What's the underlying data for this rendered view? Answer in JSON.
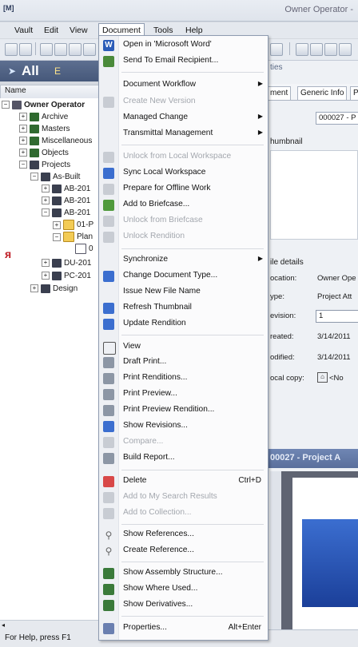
{
  "app": {
    "icon_text": "[M]",
    "title": "Owner Operator -"
  },
  "menubar": [
    "Vault",
    "Edit",
    "View",
    "Document",
    "Tools",
    "Help"
  ],
  "leftpanel": {
    "band_label": "All",
    "band_extra": "E",
    "header": "Name"
  },
  "tree": [
    {
      "label": "Owner Operator",
      "level": 0,
      "bold": true,
      "icon": "db"
    },
    {
      "label": "Archive",
      "level": 1,
      "icon": "book"
    },
    {
      "label": "Masters",
      "level": 1,
      "icon": "book"
    },
    {
      "label": "Miscellaneous",
      "level": 1,
      "icon": "book"
    },
    {
      "label": "Objects",
      "level": 1,
      "icon": "book"
    },
    {
      "label": "Projects",
      "level": 1,
      "icon": "proj"
    },
    {
      "label": "As-Built",
      "level": 2,
      "icon": "proj"
    },
    {
      "label": "AB-201",
      "level": 3,
      "icon": "proj"
    },
    {
      "label": "AB-201",
      "level": 3,
      "icon": "proj"
    },
    {
      "label": "AB-201",
      "level": 3,
      "icon": "proj"
    },
    {
      "label": "01-P",
      "level": 4,
      "icon": "folder"
    },
    {
      "label": "Plan",
      "level": 4,
      "icon": "folder"
    },
    {
      "label": "0",
      "level": 5,
      "icon": "doc"
    },
    {
      "label": "DU-201",
      "level": 3,
      "icon": "proj"
    },
    {
      "label": "PC-201",
      "level": 3,
      "icon": "proj"
    },
    {
      "label": "Design",
      "level": 2,
      "icon": "proj"
    }
  ],
  "dropdown": [
    {
      "label": "Open in 'Microsoft Word'",
      "icon": "word",
      "type": "item"
    },
    {
      "label": "Send To Email Recipient...",
      "icon": "mail",
      "type": "item"
    },
    {
      "type": "sep"
    },
    {
      "label": "Document Workflow",
      "type": "item",
      "submenu": true
    },
    {
      "label": "Create New Version",
      "icon": "grey",
      "type": "item",
      "disabled": true
    },
    {
      "label": "Managed Change",
      "type": "item",
      "submenu": true
    },
    {
      "label": "Transmittal Management",
      "type": "item",
      "submenu": true
    },
    {
      "type": "sep"
    },
    {
      "label": "Unlock from Local Workspace",
      "icon": "grey",
      "type": "item",
      "disabled": true
    },
    {
      "label": "Sync Local Workspace",
      "icon": "blue",
      "type": "item"
    },
    {
      "label": "Prepare for Offline Work",
      "icon": "grey",
      "type": "item"
    },
    {
      "label": "Add to Briefcase...",
      "icon": "green",
      "type": "item"
    },
    {
      "label": "Unlock from Briefcase",
      "icon": "grey",
      "type": "item",
      "disabled": true
    },
    {
      "label": "Unlock Rendition",
      "icon": "grey",
      "type": "item",
      "disabled": true
    },
    {
      "type": "sep"
    },
    {
      "label": "Synchronize",
      "type": "item",
      "submenu": true
    },
    {
      "label": "Change Document Type...",
      "icon": "blue",
      "type": "item"
    },
    {
      "label": "Issue New File Name",
      "type": "item"
    },
    {
      "label": "Refresh Thumbnail",
      "icon": "blue",
      "type": "item"
    },
    {
      "label": "Update Rendition",
      "icon": "blue",
      "type": "item"
    },
    {
      "type": "sep"
    },
    {
      "label": "View",
      "icon": "view",
      "type": "item"
    },
    {
      "label": "Draft Print...",
      "icon": "print",
      "type": "item"
    },
    {
      "label": "Print Renditions...",
      "icon": "print",
      "type": "item"
    },
    {
      "label": "Print Preview...",
      "icon": "print",
      "type": "item"
    },
    {
      "label": "Print Preview Rendition...",
      "icon": "print",
      "type": "item"
    },
    {
      "label": "Show Revisions...",
      "icon": "blue",
      "type": "item"
    },
    {
      "label": "Compare...",
      "icon": "grey",
      "type": "item",
      "disabled": true
    },
    {
      "label": "Build Report...",
      "icon": "print",
      "type": "item"
    },
    {
      "type": "sep"
    },
    {
      "label": "Delete",
      "icon": "red",
      "type": "item",
      "shortcut": "Ctrl+D"
    },
    {
      "label": "Add to My Search Results",
      "icon": "grey",
      "type": "item",
      "disabled": true
    },
    {
      "label": "Add to Collection...",
      "icon": "grey",
      "type": "item",
      "disabled": true
    },
    {
      "type": "sep"
    },
    {
      "label": "Show References...",
      "icon": "link",
      "type": "item"
    },
    {
      "label": "Create Reference...",
      "icon": "link",
      "type": "item"
    },
    {
      "type": "sep"
    },
    {
      "label": "Show Assembly Structure...",
      "icon": "tree",
      "type": "item"
    },
    {
      "label": "Show Where Used...",
      "icon": "tree",
      "type": "item"
    },
    {
      "label": "Show Derivatives...",
      "icon": "tree",
      "type": "item"
    },
    {
      "type": "sep"
    },
    {
      "label": "Properties...",
      "icon": "props",
      "type": "item",
      "shortcut": "Alt+Enter"
    }
  ],
  "rightpane": {
    "props_label": "ties",
    "tabs": [
      "ment",
      "Generic Info",
      "P"
    ],
    "doc_number": "000027 - P",
    "thumbnail_label": "humbnail",
    "file_details_label": "ile details",
    "fields": [
      {
        "label": "ocation:",
        "value": "Owner Ope"
      },
      {
        "label": "ype:",
        "value": "Project Att"
      },
      {
        "label": "evision:",
        "value": "1"
      },
      {
        "label": "reated:",
        "value": "3/14/2011"
      },
      {
        "label": "odified:",
        "value": "3/14/2011"
      },
      {
        "label": "ocal copy:",
        "value": "<No"
      }
    ],
    "preview_title": "00027 - Project A"
  },
  "status": "For Help, press F1"
}
